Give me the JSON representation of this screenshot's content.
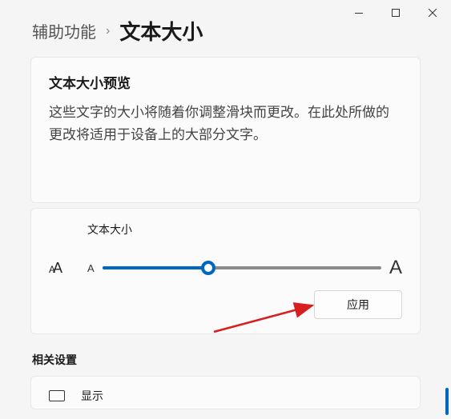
{
  "breadcrumb": {
    "parent": "辅助功能",
    "separator": "›",
    "current": "文本大小"
  },
  "preview": {
    "title": "文本大小预览",
    "text": "这些文字的大小将随着你调整滑块而更改。在此处所做的更改将适用于设备上的大部分文字。"
  },
  "slider": {
    "label": "文本大小",
    "min_marker": "A",
    "max_marker": "A",
    "apply_label": "应用"
  },
  "related": {
    "section_title": "相关设置",
    "display_title": "显示"
  },
  "chart_data": {
    "type": "slider",
    "min": 100,
    "max": 225,
    "value": 148,
    "unit": "percent"
  }
}
